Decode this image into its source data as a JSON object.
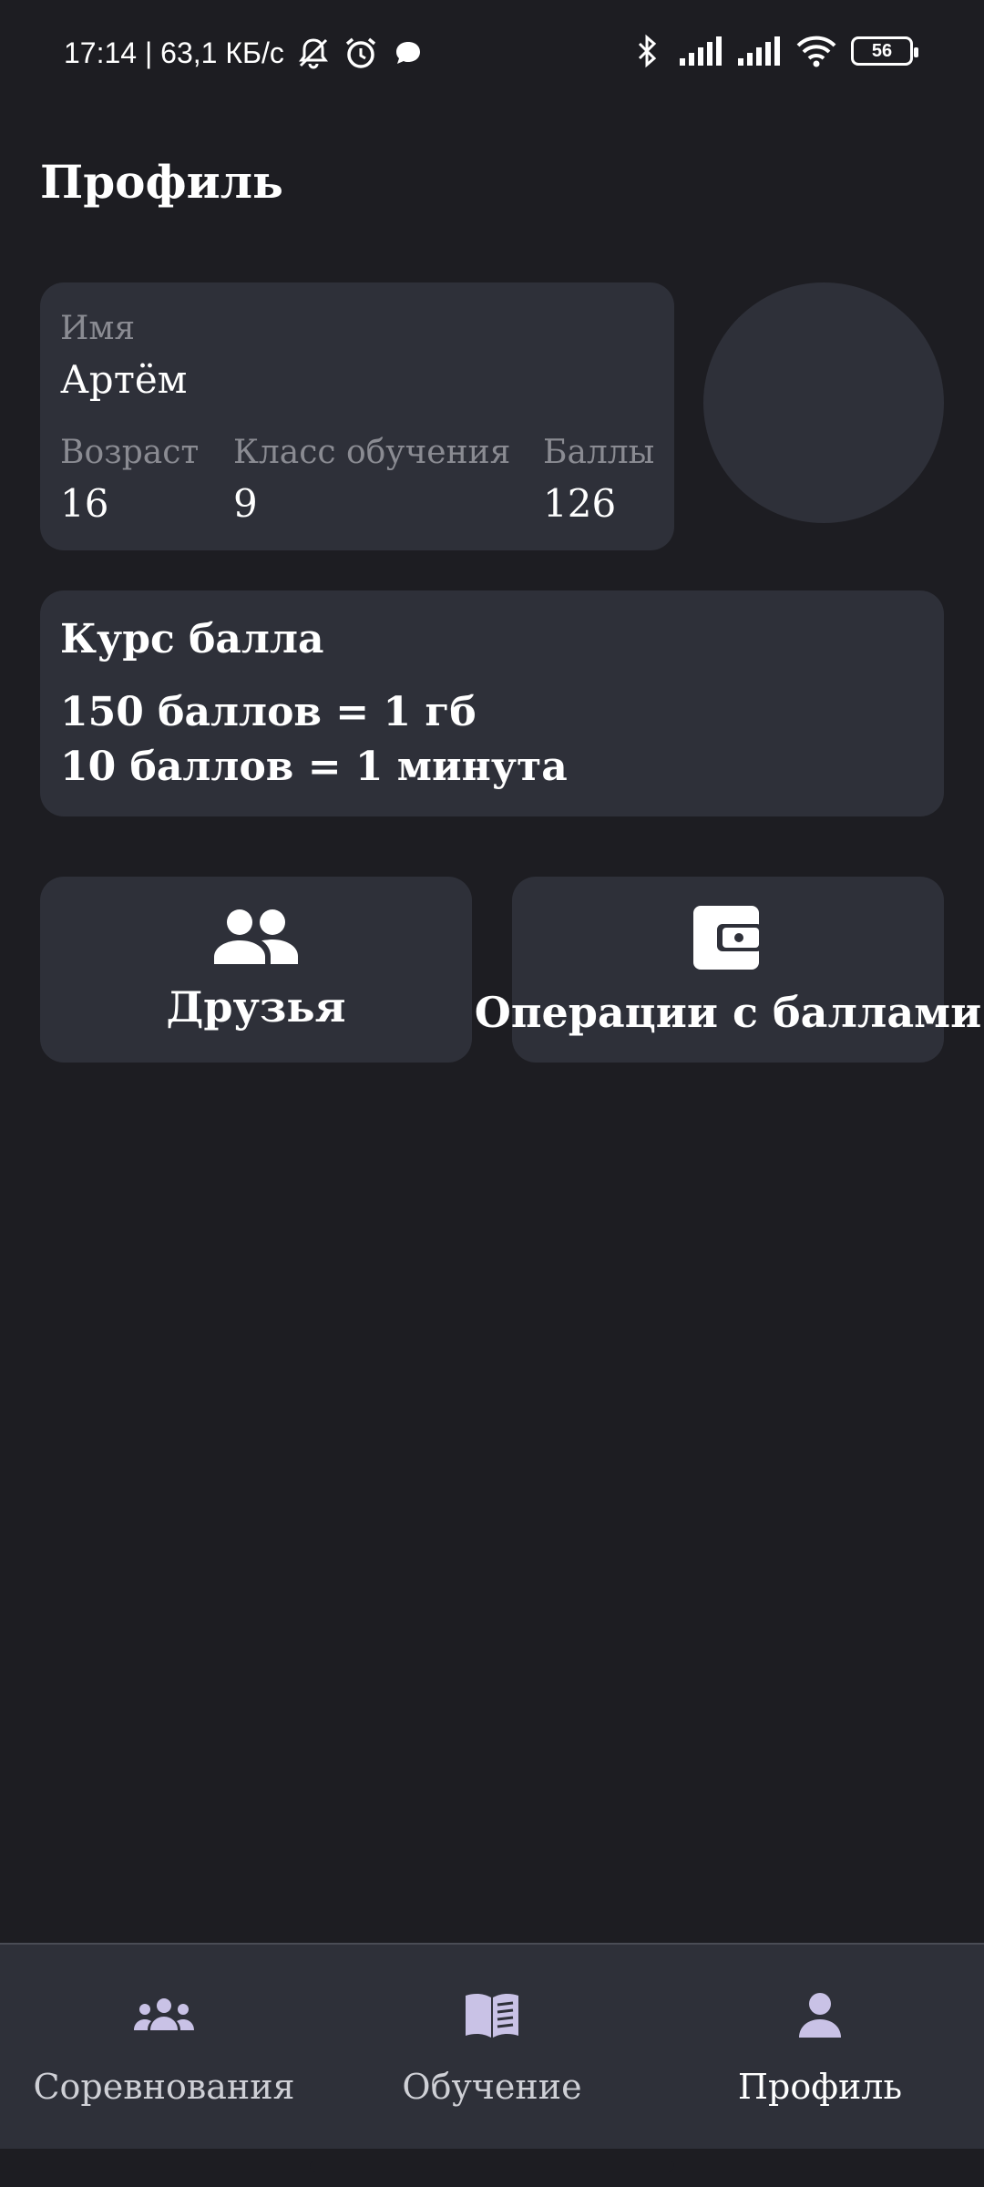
{
  "status_bar": {
    "time_speed": "17:14 | 63,1 КБ/с",
    "battery": "56",
    "icons": [
      "mute-bell-icon",
      "alarm-icon",
      "chat-icon",
      "bluetooth-icon",
      "signal-icon",
      "signal-icon",
      "wifi-icon",
      "battery-icon"
    ]
  },
  "header": {
    "title": "Профиль"
  },
  "profile": {
    "name_label": "Имя",
    "name_value": "Артём",
    "age_label": "Возраст",
    "age_value": "16",
    "class_label": "Класс обучения",
    "class_value": "9",
    "points_label": "Баллы",
    "points_value": "126"
  },
  "rate": {
    "title": "Курс балла",
    "line1": "150 баллов = 1 гб",
    "line2": "10 баллов = 1 минута"
  },
  "actions": {
    "friends_label": "Друзья",
    "friends_icon": "people-icon",
    "operations_label": "Операции с баллами",
    "operations_icon": "wallet-icon"
  },
  "bottom_nav": {
    "items": [
      {
        "label": "Соревнования",
        "icon": "group-icon"
      },
      {
        "label": "Обучение",
        "icon": "book-icon"
      },
      {
        "label": "Профиль",
        "icon": "person-icon",
        "active": true
      }
    ]
  },
  "colors": {
    "background": "#1d1d22",
    "card": "#2e3039",
    "label": "#8a8b92",
    "text": "#ffffff",
    "nav_icon": "#c9c2e6"
  }
}
